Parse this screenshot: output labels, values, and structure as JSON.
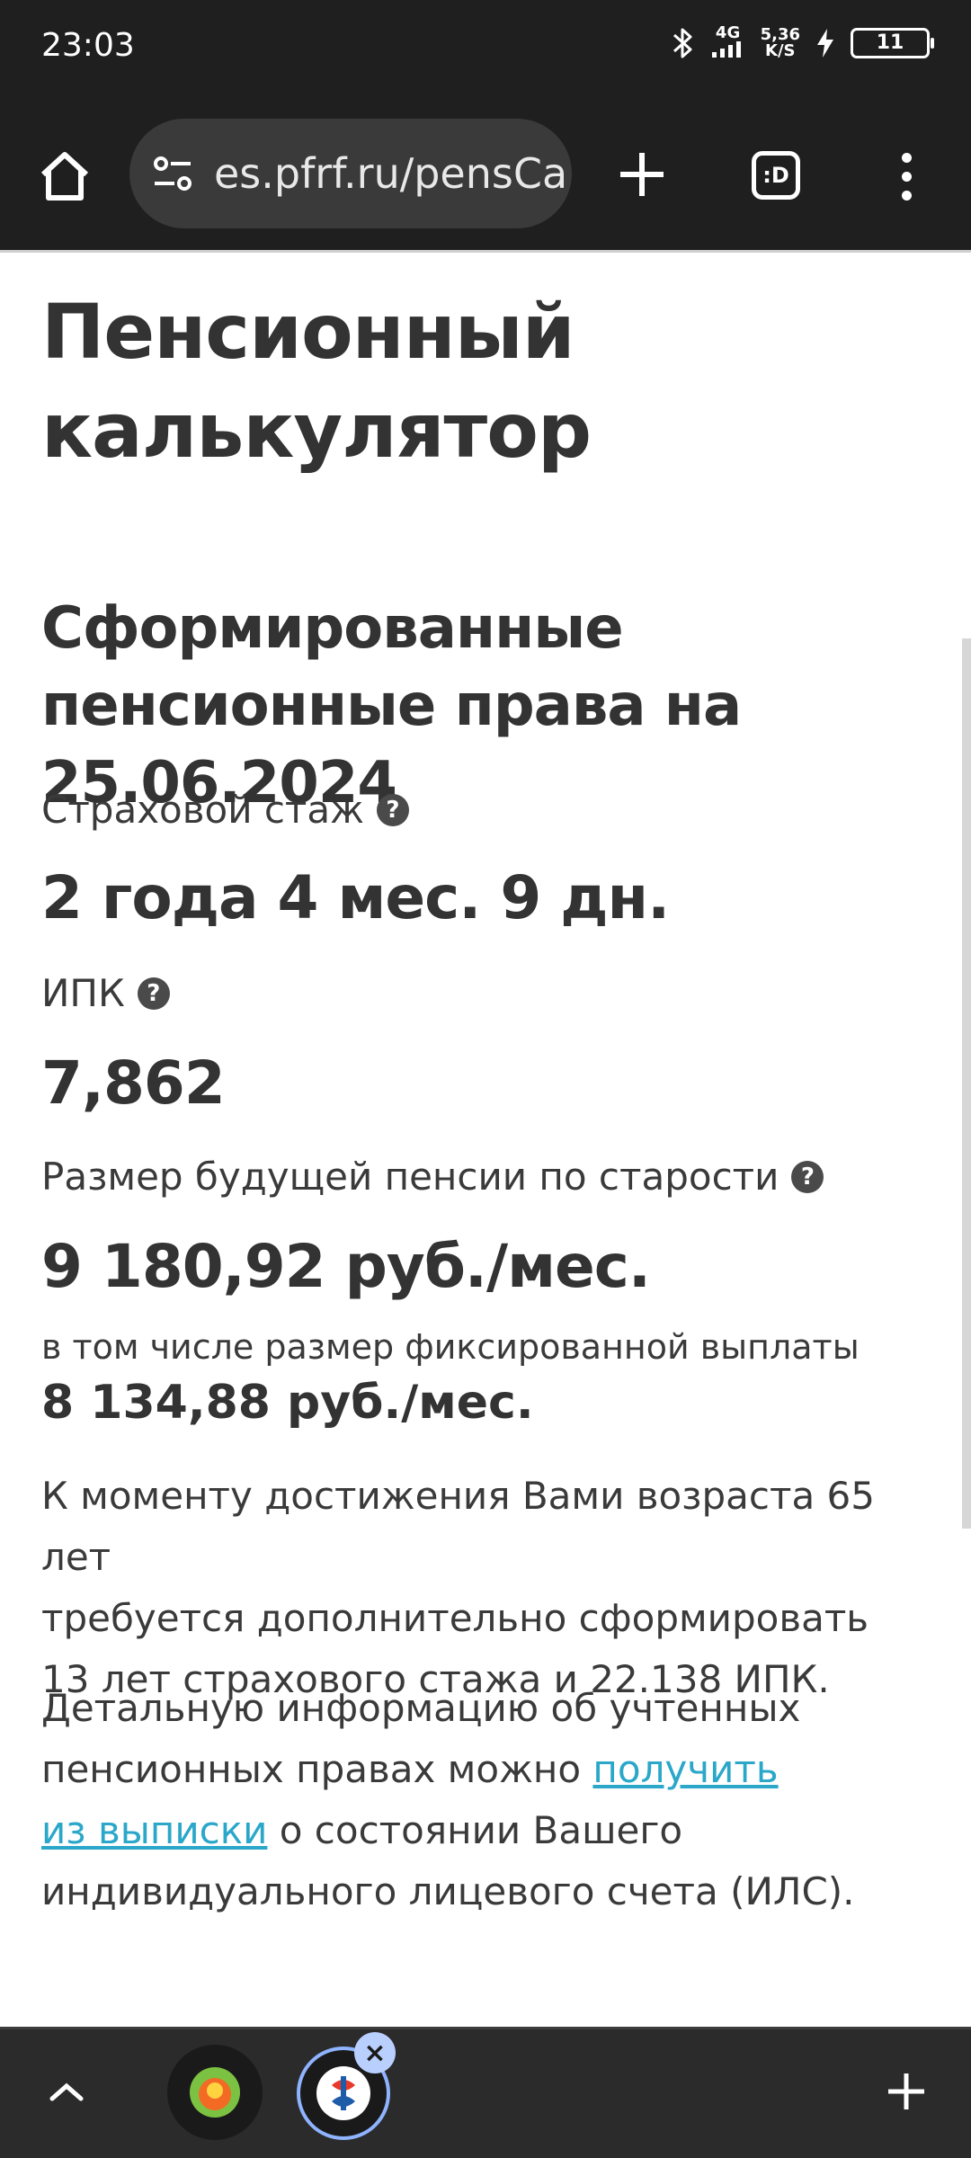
{
  "status": {
    "time": "23:03",
    "network": "4G",
    "speed_top": "5,36",
    "speed_bottom": "K/S",
    "battery": "11"
  },
  "browser": {
    "url": "es.pfrf.ru/pensCa",
    "tabs_label": ":D"
  },
  "page": {
    "title": "Пенсионный калькулятор",
    "section_title": "Сформированные пенсионные права на 25.06.2024",
    "insurance_label": "Страховой стаж",
    "insurance_value": "2 года 4 мес. 9 дн.",
    "ipk_label": "ИПК",
    "ipk_value": "7,862",
    "pension_label": "Размер будущей пенсии по старости",
    "pension_value": "9 180,92 руб./мес.",
    "fixed_label": "в том числе размер фиксированной выплаты",
    "fixed_value": "8 134,88 руб./мес.",
    "note_line1": "К моменту достижения Вами возраста 65 лет",
    "note_line2": "требуется дополнительно сформировать",
    "note_line3": "13 лет страхового стажа и 22.138 ИПК.",
    "info_line1": "Детальную информацию об учтенных",
    "info_line2_pre": "пенсионных правах можно ",
    "info_link_part1": "получить",
    "info_link_part2": "из выписки",
    "info_line3_post": " о состоянии Вашего",
    "info_line4": "индивидуального лицевого счета (ИЛС)."
  },
  "colors": {
    "link": "#2aa7c9",
    "bar": "#1f1f1f",
    "text": "#333333"
  },
  "icons": [
    "home-icon",
    "tune-icon",
    "plus-icon",
    "menu-icon",
    "help-icon",
    "chevron-up-icon",
    "close-icon"
  ]
}
